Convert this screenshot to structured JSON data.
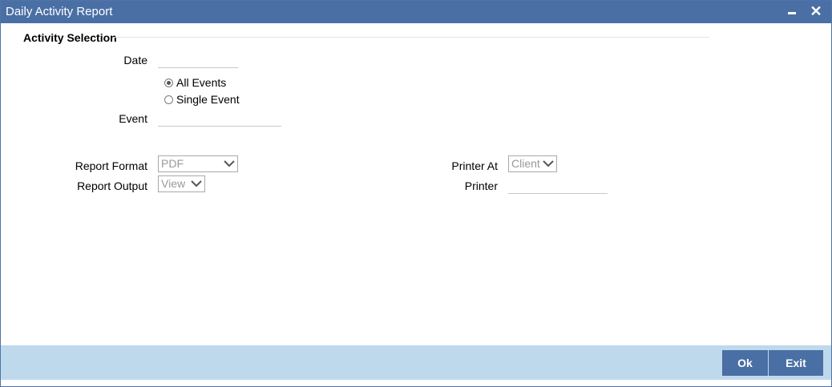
{
  "window": {
    "title": "Daily Activity Report",
    "minimize_icon": "minimize-icon",
    "close_glyph": "✕"
  },
  "section": {
    "title": "Activity Selection"
  },
  "fields": {
    "date_label": "Date",
    "date_value": "",
    "all_events_label": "All Events",
    "single_event_label": "Single Event",
    "selected_event_mode": "All Events",
    "event_label": "Event",
    "event_value": "",
    "report_format_label": "Report Format",
    "report_format_value": "PDF",
    "report_output_label": "Report Output",
    "report_output_value": "View",
    "printer_at_label": "Printer At",
    "printer_at_value": "Client",
    "printer_label": "Printer",
    "printer_value": ""
  },
  "buttons": {
    "ok": "Ok",
    "exit": "Exit"
  },
  "colors": {
    "titlebar": "#4a6fa5",
    "footer": "#bfd9ec",
    "button": "#4a6fa5"
  }
}
